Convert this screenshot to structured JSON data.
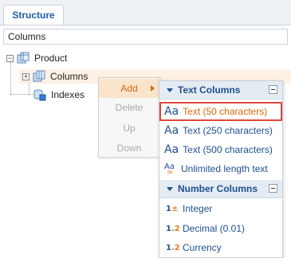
{
  "tabs": [
    {
      "label": "Structure",
      "active": true
    }
  ],
  "section_header": "Columns",
  "tree": {
    "root": {
      "label": "Product",
      "expander": "⊟"
    },
    "children": [
      {
        "label": "Columns",
        "expander": "⊞"
      },
      {
        "label": "Indexes"
      }
    ]
  },
  "context_menu": {
    "items": [
      {
        "label": "Add",
        "enabled": true,
        "has_submenu": true
      },
      {
        "label": "Delete",
        "enabled": false
      },
      {
        "label": "Up",
        "enabled": false
      },
      {
        "label": "Down",
        "enabled": false
      }
    ]
  },
  "submenu": {
    "groups": [
      {
        "title": "Text Columns",
        "items": [
          {
            "label": "Text (50 characters)",
            "icon": "Aa",
            "selected": true
          },
          {
            "label": "Text (250 characters)",
            "icon": "Aa"
          },
          {
            "label": "Text (500 characters)",
            "icon": "Aa"
          },
          {
            "label": "Unlimited length text",
            "icon": "Aa∞"
          }
        ]
      },
      {
        "title": "Number Columns",
        "items": [
          {
            "label": "Integer",
            "icon": "1±"
          },
          {
            "label": "Decimal (0.01)",
            "icon": "1.2"
          },
          {
            "label": "Currency",
            "icon": "1.2"
          }
        ]
      }
    ]
  },
  "colors": {
    "accent_blue": "#1e4f8f",
    "accent_orange": "#d86a10",
    "selection_border": "#e0453a"
  }
}
